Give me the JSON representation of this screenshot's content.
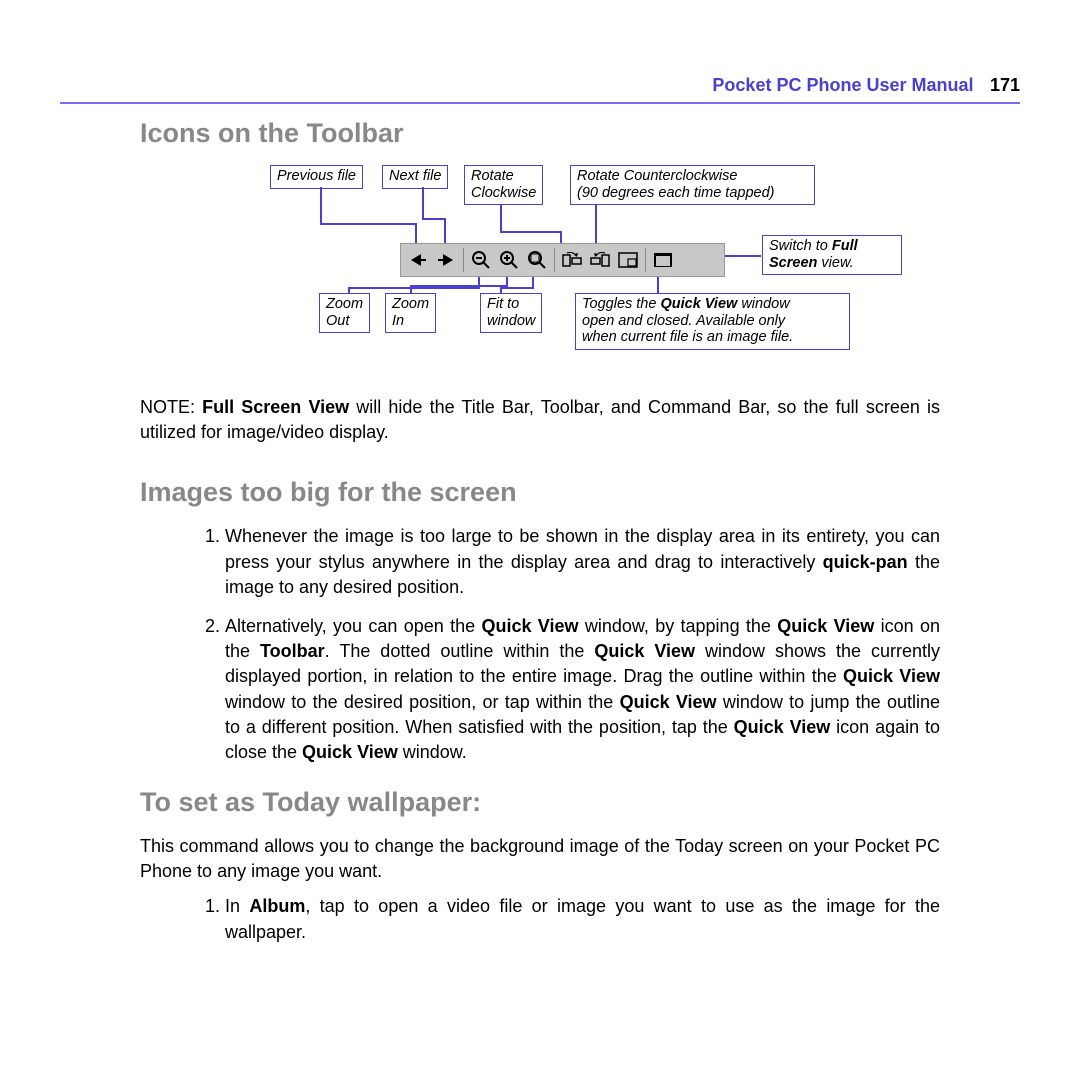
{
  "header": {
    "title": "Pocket PC Phone User Manual",
    "page": "171"
  },
  "section1": {
    "heading": "Icons on the Toolbar",
    "labels": {
      "prev": "Previous file",
      "next": "Next file",
      "rotcw1": "Rotate",
      "rotcw2": "Clockwise",
      "rotccw1": "Rotate Counterclockwise",
      "rotccw2": "(90 degrees each time tapped)",
      "zoomout1": "Zoom",
      "zoomout2": "Out",
      "zoomin1": "Zoom",
      "zoomin2": "In",
      "fit1": "Fit to",
      "fit2": "window",
      "qv1": "Toggles the ",
      "qv_bold": "Quick View",
      "qv2": " window",
      "qv3": "open and closed. Available only",
      "qv4": "when current file is an image file.",
      "fs1": "Switch to ",
      "fs_bold": "Full",
      "fs2": "Screen",
      "fs3": " view."
    },
    "note_prefix": "NOTE: ",
    "note_bold": "Full Screen View",
    "note_rest": " will hide the Title Bar, Toolbar, and Command Bar, so the full screen is utilized for image/video display."
  },
  "section2": {
    "heading": "Images too big for the screen",
    "item1_a": "Whenever the image is too large to be shown in the display area in its entirety, you can press your stylus anywhere in the display area and drag to interactively ",
    "item1_bold": "quick-pan",
    "item1_b": " the image to any desired position.",
    "item2_a": "Alternatively, you can open the ",
    "qv": "Quick View",
    "item2_b": " window, by tapping the ",
    "item2_c": " icon on the ",
    "toolbar": "Toolbar",
    "item2_d": ". The dotted outline within the ",
    "item2_e": " window shows the currently displayed portion, in relation to the entire image. Drag the outline within the ",
    "item2_f": " window to the desired position, or tap within the ",
    "item2_g": " window to jump the outline to a different position. When satisfied with the position, tap the ",
    "item2_h": " icon again to close the ",
    "item2_i": " window."
  },
  "section3": {
    "heading": "To set as Today wallpaper:",
    "intro": "This command allows you to change the background image of the Today screen on your Pocket PC Phone to any image you want.",
    "item1_a": "In ",
    "album": "Album",
    "item1_b": ", tap to open a video file or image you want to use as the image for the wallpaper."
  }
}
